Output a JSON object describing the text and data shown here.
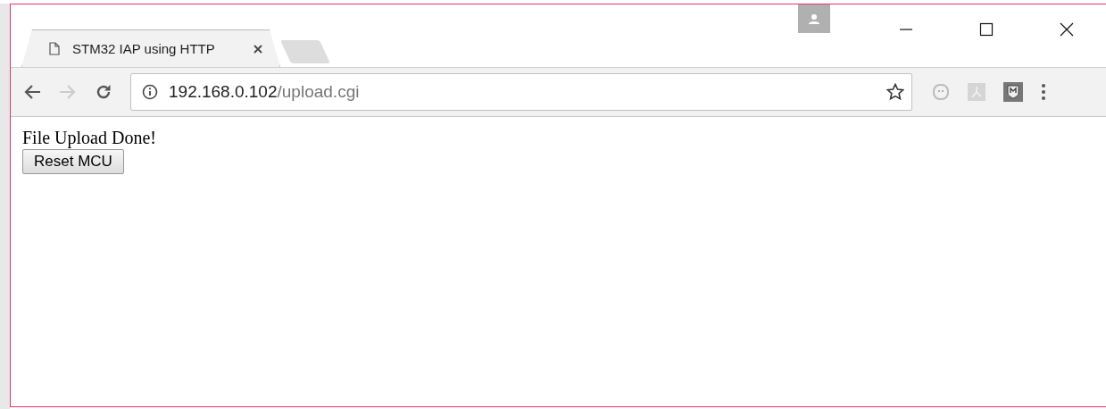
{
  "window": {
    "controls": [
      {
        "kind": "minimize"
      },
      {
        "kind": "maximize"
      },
      {
        "kind": "close"
      }
    ]
  },
  "tabs": [
    {
      "title": "STM32 IAP using HTTP",
      "selected": true,
      "kind": "page"
    },
    {
      "kind": "new"
    }
  ],
  "address_bar": {
    "host": "192.168.0.102",
    "path": "/upload.cgi"
  },
  "page": {
    "message": "File Upload Done!",
    "button": "Reset MCU"
  }
}
